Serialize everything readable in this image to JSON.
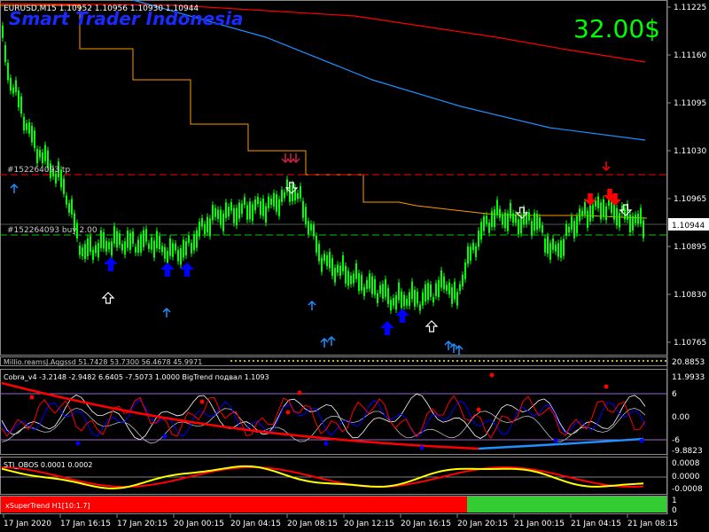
{
  "window": {
    "symbol_info": "EURUSD,M15  1.10952 1.10956 1.10930 1.10944",
    "watermark": "Smart Trader Indonesia",
    "profit": "32.00$",
    "profit_color": "#00ff00",
    "watermark_color": "#1a2bff"
  },
  "main_panel": {
    "price_axis": [
      "1.11225",
      "1.11160",
      "1.11095",
      "1.11030",
      "1.10965",
      "1.10895",
      "1.10830",
      "1.10765"
    ],
    "current_price": "1.10944",
    "tp_label": "#152264093 tp",
    "buy_label": "#152264093 buy 2.00",
    "levels": {
      "tp": 1.1103,
      "entry": 1.10928
    }
  },
  "panels": {
    "info_line": "Millio.reamsJ.Aqgssd 51.7428 53.7300 56.4678 45.9971",
    "info_axis": "20.8853",
    "osc_title": "Cobra_v4 -3.2148 -2.9482 6.6405 -7.5073 1.0000  BigTrend подвал 1.1093",
    "osc_axis": [
      "11.9933",
      "6",
      "0.00",
      "-6",
      "-9.8823"
    ],
    "sti_title": "STI_OBOS 0.0001 0.0002",
    "sti_axis": [
      "0.0008",
      "0.0000",
      "-0.0008"
    ],
    "xst_title": "xSuperTrend H1[10:1.7]",
    "xst_axis": [
      "1",
      "0"
    ],
    "xst_split": 0.7
  },
  "time_axis": [
    "17 Jan 2020",
    "17 Jan 16:15",
    "17 Jan 20:15",
    "20 Jan 00:15",
    "20 Jan 04:15",
    "20 Jan 08:15",
    "20 Jan 12:15",
    "20 Jan 16:15",
    "20 Jan 20:15",
    "21 Jan 00:15",
    "21 Jan 04:15",
    "21 Jan 08:15"
  ],
  "colors": {
    "candle": "#00ff00",
    "up_arrow": "#1e90ff",
    "big_up": "#0000ff",
    "down_arrow": "#ff0000",
    "ma_orange": "#ff9900",
    "ma_red": "#ff0000",
    "ma_blue": "#1e90ff"
  }
}
